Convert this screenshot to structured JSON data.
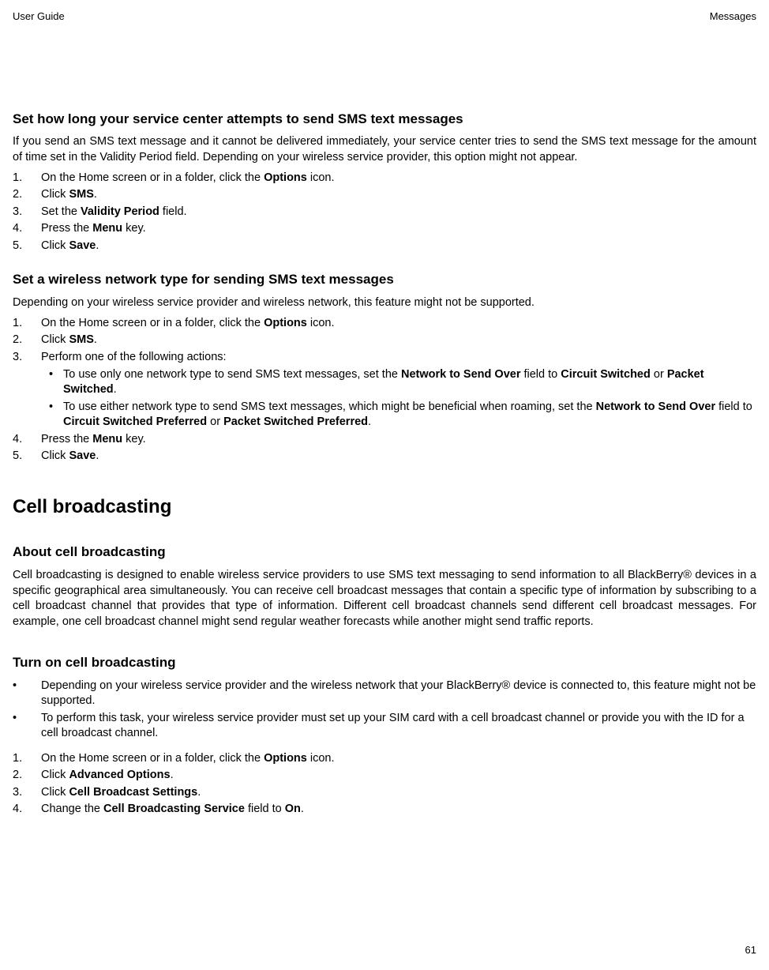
{
  "header": {
    "left": "User Guide",
    "right": "Messages"
  },
  "page_number": "61",
  "s1": {
    "title": "Set how long your service center attempts to send SMS text messages",
    "intro": "If you send an SMS text message and it cannot be delivered immediately, your service center tries to send the SMS text message for the amount of time set in the Validity Period field. Depending on your wireless service provider, this option might not appear.",
    "step1a": "On the Home screen or in a folder, click the ",
    "step1b": "Options",
    "step1c": " icon.",
    "step2a": "Click ",
    "step2b": "SMS",
    "step2c": ".",
    "step3a": "Set the ",
    "step3b": "Validity Period",
    "step3c": " field.",
    "step4a": "Press the ",
    "step4b": "Menu",
    "step4c": " key.",
    "step5a": "Click ",
    "step5b": "Save",
    "step5c": "."
  },
  "s2": {
    "title": "Set a wireless network type for sending SMS text messages",
    "intro": "Depending on your wireless service provider and wireless network, this feature might not be supported.",
    "step1a": "On the Home screen or in a folder, click the ",
    "step1b": "Options",
    "step1c": " icon.",
    "step2a": "Click ",
    "step2b": "SMS",
    "step2c": ".",
    "step3": "Perform one of the following actions:",
    "b1a": "To use only one network type to send SMS text messages, set the ",
    "b1b": "Network to Send Over",
    "b1c": " field to ",
    "b1d": "Circuit Switched",
    "b1e": " or ",
    "b1f": "Packet Switched",
    "b1g": ".",
    "b2a": "To use either network type to send SMS text messages, which might be beneficial when roaming, set the ",
    "b2b": "Network to Send Over",
    "b2c": " field to ",
    "b2d": "Circuit Switched Preferred",
    "b2e": " or ",
    "b2f": "Packet Switched Preferred",
    "b2g": ".",
    "step4a": "Press the ",
    "step4b": "Menu",
    "step4c": " key.",
    "step5a": "Click ",
    "step5b": "Save",
    "step5c": "."
  },
  "s3": {
    "h1": "Cell broadcasting",
    "about_title": "About cell broadcasting",
    "about_body": "Cell broadcasting is designed to enable wireless service providers to use SMS text messaging to send information to all BlackBerry® devices in a specific geographical area simultaneously. You can receive cell broadcast messages that contain a specific type of information by subscribing to a cell broadcast channel that provides that type of information. Different cell broadcast channels send different cell broadcast messages. For example, one cell broadcast channel might send regular weather forecasts while another might send traffic reports.",
    "turn_title": "Turn on cell broadcasting",
    "nb1": "Depending on your wireless service provider and the wireless network that your BlackBerry® device is connected to, this feature might not be supported.",
    "nb2": "To perform this task, your wireless service provider must set up your SIM card with a cell broadcast channel or provide you with the ID for a cell broadcast channel.",
    "step1a": "On the Home screen or in a folder, click the ",
    "step1b": "Options",
    "step1c": " icon.",
    "step2a": "Click ",
    "step2b": "Advanced Options",
    "step2c": ".",
    "step3a": "Click ",
    "step3b": "Cell Broadcast Settings",
    "step3c": ".",
    "step4a": "Change the ",
    "step4b": "Cell Broadcasting Service",
    "step4c": " field to ",
    "step4d": "On",
    "step4e": "."
  }
}
